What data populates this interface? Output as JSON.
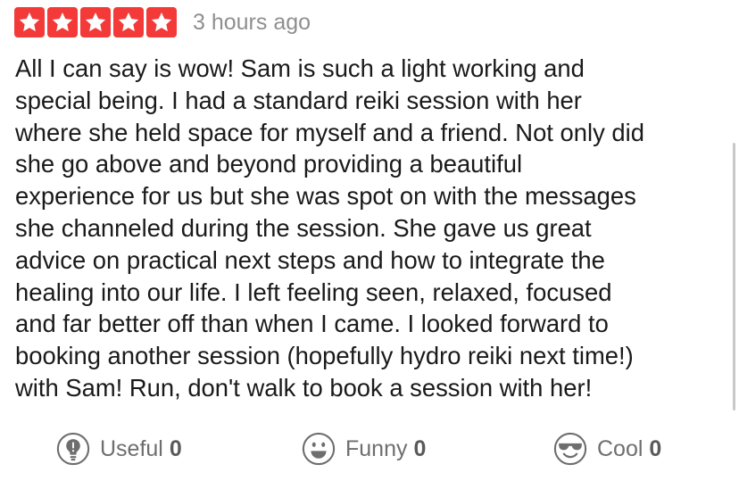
{
  "review": {
    "rating": 5,
    "rating_max": 5,
    "star_color": "#f43939",
    "timestamp": "3 hours ago",
    "body_lines": [
      "All I can say is wow! Sam is such a light working and",
      "special being. I had a standard reiki session with her",
      "where she held space for myself and a friend. Not only did",
      "she go above and beyond providing a beautiful",
      "experience for us but she was spot on with the messages",
      "she channeled during the session. She gave us great",
      "advice on practical next steps and how to integrate the",
      "healing into our life. I left feeling seen, relaxed, focused",
      "and far better off than when I came. I looked forward to",
      "booking another session (hopefully hydro reiki next time!)",
      "with Sam! Run, don't walk to book a session with her!"
    ]
  },
  "reactions": {
    "useful": {
      "label": "Useful",
      "count": "0",
      "icon": "lightbulb-icon"
    },
    "funny": {
      "label": "Funny",
      "count": "0",
      "icon": "smiley-icon"
    },
    "cool": {
      "label": "Cool",
      "count": "0",
      "icon": "sunglasses-icon"
    }
  }
}
